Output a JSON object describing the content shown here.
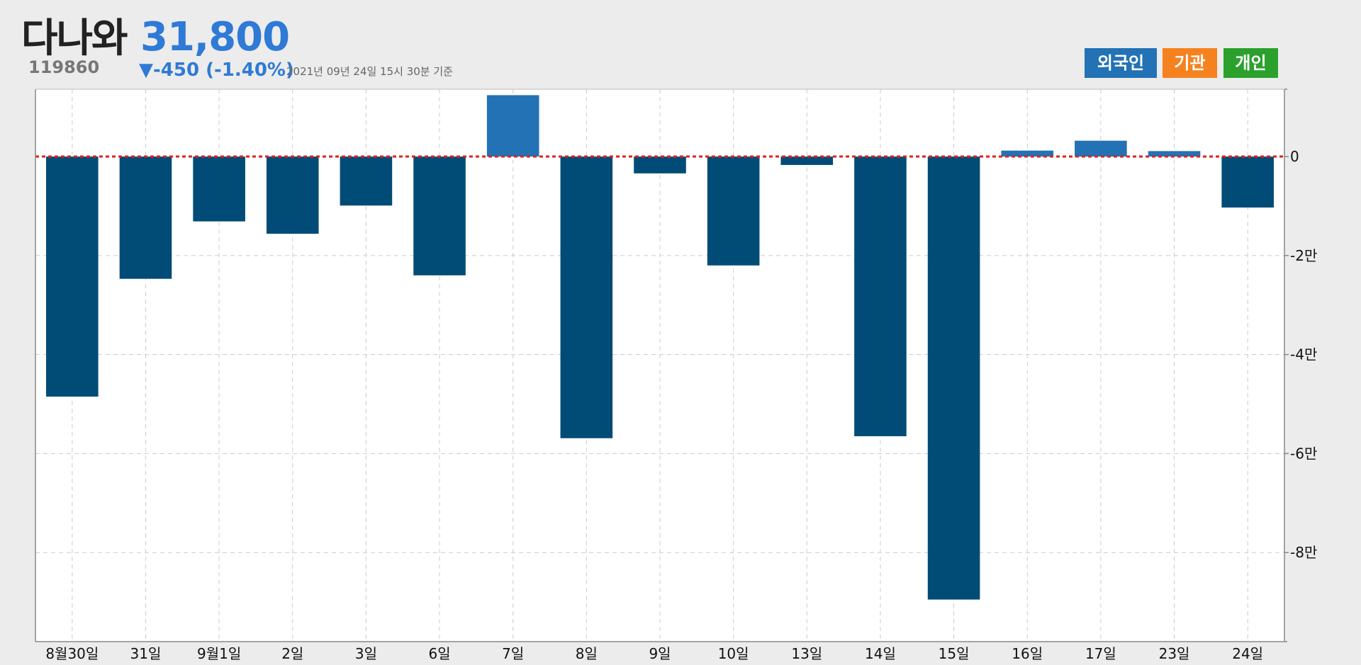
{
  "header": {
    "stock_name": "다나와",
    "stock_code": "119860",
    "price": "31,800",
    "change": "▼-450 (-1.40%)",
    "timestamp": "2021년 09년 24일 15시 30분 기준"
  },
  "legend": [
    {
      "label": "외국인",
      "color": "#2272b5"
    },
    {
      "label": "기관",
      "color": "#f5821f"
    },
    {
      "label": "개인",
      "color": "#2ca02c"
    }
  ],
  "colors": {
    "background": "#ececec",
    "plot_bg": "#ffffff",
    "bar_negative": "#004c76",
    "bar_positive": "#2272b5",
    "zero_line": "#e02020",
    "grid": "#cccccc",
    "price": "#2f7ad6"
  },
  "chart_data": {
    "type": "bar",
    "series_name": "외국인",
    "categories": [
      "8월30일",
      "31일",
      "9월1일",
      "2일",
      "3일",
      "6일",
      "7일",
      "8일",
      "9일",
      "10일",
      "13일",
      "14일",
      "15일",
      "16일",
      "17일",
      "23일",
      "24일"
    ],
    "values": [
      -48500,
      -24700,
      -13100,
      -15600,
      -9900,
      -24000,
      12400,
      -56900,
      -3400,
      -22000,
      -1700,
      -56500,
      -89500,
      1200,
      3200,
      1100,
      -10300
    ],
    "y_ticks": [
      0,
      -20000,
      -40000,
      -60000,
      -80000
    ],
    "y_tick_labels": [
      "0",
      "-2만",
      "-4만",
      "-6만",
      "-8만"
    ],
    "ylim": [
      -98000,
      13600
    ],
    "zero_line": true,
    "grid": true,
    "y_axis_side": "right"
  }
}
